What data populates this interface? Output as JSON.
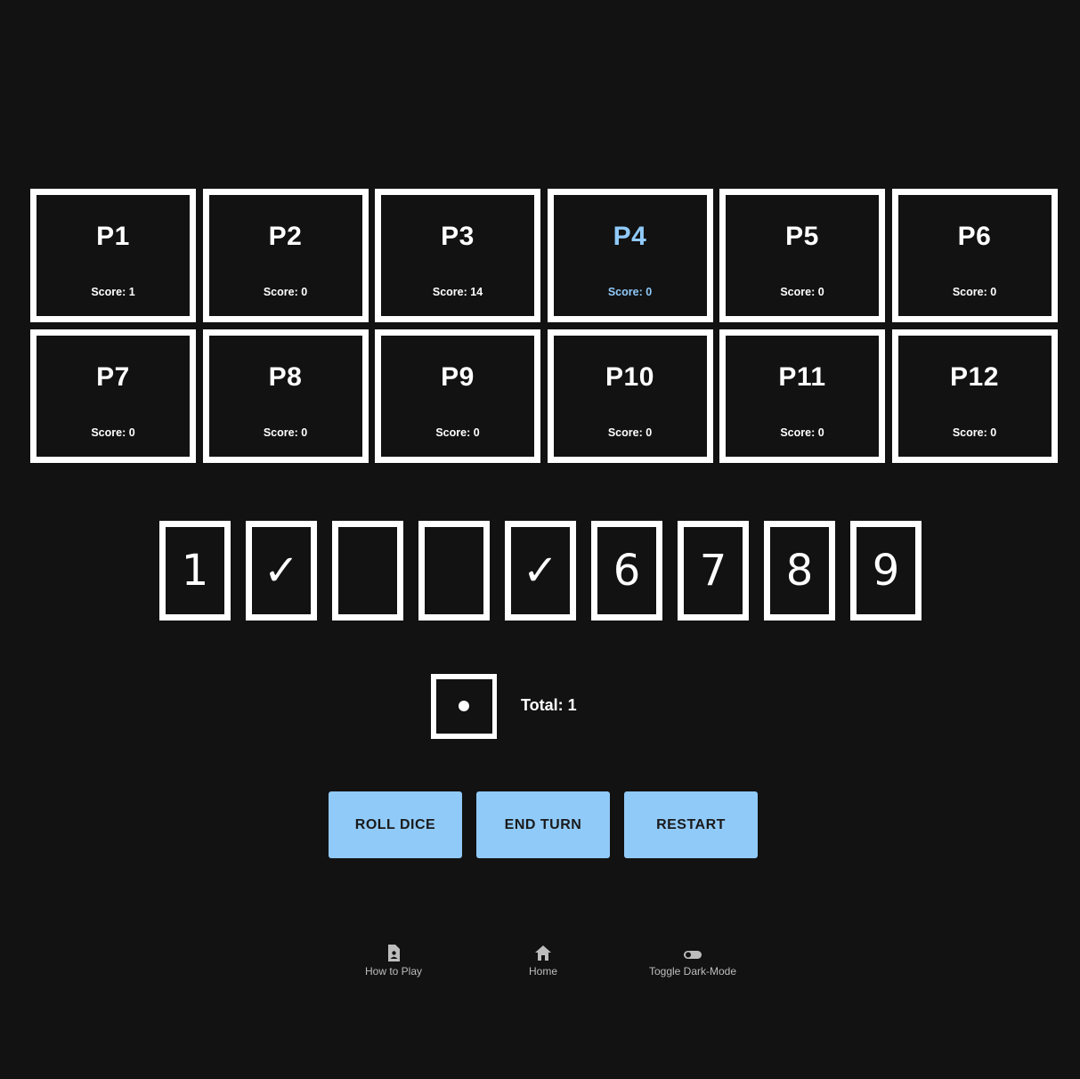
{
  "players": [
    {
      "name": "P1",
      "score": "Score: 1",
      "active": false
    },
    {
      "name": "P2",
      "score": "Score: 0",
      "active": false
    },
    {
      "name": "P3",
      "score": "Score: 14",
      "active": false
    },
    {
      "name": "P4",
      "score": "Score: 0",
      "active": true
    },
    {
      "name": "P5",
      "score": "Score: 0",
      "active": false
    },
    {
      "name": "P6",
      "score": "Score: 0",
      "active": false
    },
    {
      "name": "P7",
      "score": "Score: 0",
      "active": false
    },
    {
      "name": "P8",
      "score": "Score: 0",
      "active": false
    },
    {
      "name": "P9",
      "score": "Score: 0",
      "active": false
    },
    {
      "name": "P10",
      "score": "Score: 0",
      "active": false
    },
    {
      "name": "P11",
      "score": "Score: 0",
      "active": false
    },
    {
      "name": "P12",
      "score": "Score: 0",
      "active": false
    }
  ],
  "tiles": [
    "1",
    "✓",
    "",
    "",
    "✓",
    "6",
    "7",
    "8",
    "9"
  ],
  "dice": {
    "values": [
      1
    ],
    "total_label": "Total: 1"
  },
  "buttons": {
    "roll": "ROLL DICE",
    "end_turn": "END TURN",
    "restart": "RESTART"
  },
  "nav": {
    "how_to_play": "How to Play",
    "home": "Home",
    "toggle_dark": "Toggle Dark-Mode"
  },
  "colors": {
    "background": "#121212",
    "accent": "#90caf9",
    "foreground": "#ffffff"
  }
}
